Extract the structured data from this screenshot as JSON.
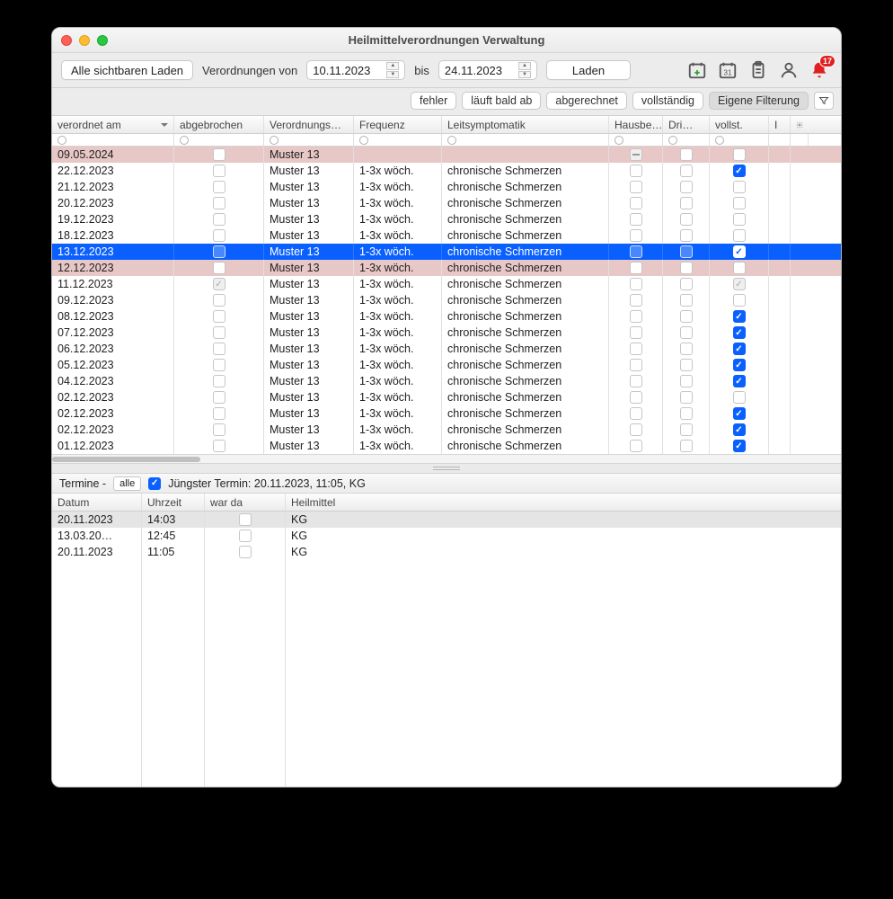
{
  "window": {
    "title": "Heilmittelverordnungen Verwaltung"
  },
  "toolbar": {
    "load_visible": "Alle sichtbaren Laden",
    "label_from": "Verordnungen von",
    "date_from": "10.11.2023",
    "label_to": "bis",
    "date_to": "24.11.2023",
    "load": "Laden",
    "notif_count": "17"
  },
  "filters": {
    "fehler": "fehler",
    "ablaufend": "läuft bald ab",
    "abgerechnet": "abgerechnet",
    "vollstaendig": "vollständig",
    "eigene": "Eigene Filterung"
  },
  "columns": {
    "verordnet": "verordnet am",
    "abgebrochen": "abgebrochen",
    "verordnung": "Verordnungs…",
    "frequenz": "Frequenz",
    "leit": "Leitsymptomatik",
    "haus": "Hausbe…",
    "dri": "Dri…",
    "vollst": "vollst.",
    "extra": "I"
  },
  "rows": [
    {
      "date": "09.05.2024",
      "vero": "Muster 13",
      "freq": "",
      "leit": "",
      "pink": true,
      "voll": false,
      "abg": false,
      "haus_minus": true
    },
    {
      "date": "22.12.2023",
      "vero": "Muster 13",
      "freq": "1-3x wöch.",
      "leit": "chronische Schmerzen",
      "voll": true
    },
    {
      "date": "21.12.2023",
      "vero": "Muster 13",
      "freq": "1-3x wöch.",
      "leit": "chronische Schmerzen",
      "voll": false
    },
    {
      "date": "20.12.2023",
      "vero": "Muster 13",
      "freq": "1-3x wöch.",
      "leit": "chronische Schmerzen",
      "voll": false
    },
    {
      "date": "19.12.2023",
      "vero": "Muster 13",
      "freq": "1-3x wöch.",
      "leit": "chronische Schmerzen",
      "voll": false
    },
    {
      "date": "18.12.2023",
      "vero": "Muster 13",
      "freq": "1-3x wöch.",
      "leit": "chronische Schmerzen",
      "voll": false
    },
    {
      "date": "13.12.2023",
      "vero": "Muster 13",
      "freq": "1-3x wöch.",
      "leit": "chronische Schmerzen",
      "voll": true,
      "selected": true
    },
    {
      "date": "12.12.2023",
      "vero": "Muster 13",
      "freq": "1-3x wöch.",
      "leit": "chronische Schmerzen",
      "voll": false,
      "pink": true
    },
    {
      "date": "11.12.2023",
      "vero": "Muster 13",
      "freq": "1-3x wöch.",
      "leit": "chronische Schmerzen",
      "voll": false,
      "abg_grey": true,
      "voll_grey": true
    },
    {
      "date": "09.12.2023",
      "vero": "Muster 13",
      "freq": "1-3x wöch.",
      "leit": "chronische Schmerzen",
      "voll": false
    },
    {
      "date": "08.12.2023",
      "vero": "Muster 13",
      "freq": "1-3x wöch.",
      "leit": "chronische Schmerzen",
      "voll": true
    },
    {
      "date": "07.12.2023",
      "vero": "Muster 13",
      "freq": "1-3x wöch.",
      "leit": "chronische Schmerzen",
      "voll": true
    },
    {
      "date": "06.12.2023",
      "vero": "Muster 13",
      "freq": "1-3x wöch.",
      "leit": "chronische Schmerzen",
      "voll": true
    },
    {
      "date": "05.12.2023",
      "vero": "Muster 13",
      "freq": "1-3x wöch.",
      "leit": "chronische Schmerzen",
      "voll": true
    },
    {
      "date": "04.12.2023",
      "vero": "Muster 13",
      "freq": "1-3x wöch.",
      "leit": "chronische Schmerzen",
      "voll": true
    },
    {
      "date": "02.12.2023",
      "vero": "Muster 13",
      "freq": "1-3x wöch.",
      "leit": "chronische Schmerzen",
      "voll": false
    },
    {
      "date": "02.12.2023",
      "vero": "Muster 13",
      "freq": "1-3x wöch.",
      "leit": "chronische Schmerzen",
      "voll": true
    },
    {
      "date": "02.12.2023",
      "vero": "Muster 13",
      "freq": "1-3x wöch.",
      "leit": "chronische Schmerzen",
      "voll": true
    },
    {
      "date": "01.12.2023",
      "vero": "Muster 13",
      "freq": "1-3x wöch.",
      "leit": "chronische Schmerzen",
      "voll": true
    }
  ],
  "lower": {
    "termine_label": "Termine -",
    "alle": "alle",
    "juengster": "Jüngster Termin: 20.11.2023, 11:05, KG",
    "cols": {
      "datum": "Datum",
      "uhrzeit": "Uhrzeit",
      "war": "war da",
      "heil": "Heilmittel"
    },
    "rows": [
      {
        "datum": "20.11.2023",
        "uhr": "14:03",
        "heil": "KG",
        "sel": true
      },
      {
        "datum": "13.03.20…",
        "uhr": "12:45",
        "heil": "KG"
      },
      {
        "datum": "20.11.2023",
        "uhr": "11:05",
        "heil": "KG"
      }
    ]
  }
}
